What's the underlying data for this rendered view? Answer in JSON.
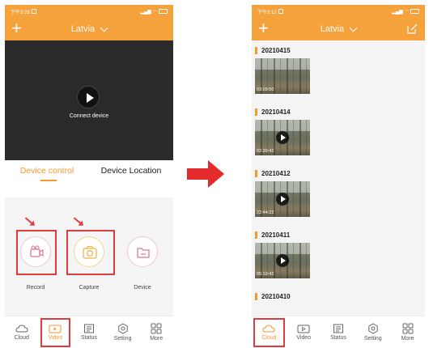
{
  "left": {
    "status_time": "下午3:28",
    "header": {
      "city": "Latvia"
    },
    "player": {
      "connect_text": "Connect device"
    },
    "tabs": [
      {
        "label": "Device control",
        "active": true
      },
      {
        "label": "Device Location",
        "active": false
      }
    ],
    "controls": [
      {
        "label": "Record",
        "icon": "video-icon"
      },
      {
        "label": "Capture",
        "icon": "camera-icon"
      },
      {
        "label": "Device",
        "icon": "folder-icon"
      }
    ],
    "nav": [
      {
        "label": "Cloud",
        "icon": "cloud-icon"
      },
      {
        "label": "Video",
        "icon": "video-icon",
        "active": true
      },
      {
        "label": "Status",
        "icon": "status-icon"
      },
      {
        "label": "Setting",
        "icon": "gear-icon"
      },
      {
        "label": "More",
        "icon": "grid-icon"
      }
    ]
  },
  "right": {
    "status_time": "下午3:12",
    "header": {
      "city": "Latvia"
    },
    "recordings": [
      {
        "date": "20210415",
        "time": "03:09:50"
      },
      {
        "date": "20210414",
        "time": "02:39:42"
      },
      {
        "date": "20210412",
        "time": "22:44:22"
      },
      {
        "date": "20210411",
        "time": "05:19:42"
      },
      {
        "date": "20210410"
      }
    ],
    "nav": [
      {
        "label": "Cloud",
        "icon": "cloud-icon",
        "active": true
      },
      {
        "label": "Video",
        "icon": "video-icon"
      },
      {
        "label": "Status",
        "icon": "status-icon"
      },
      {
        "label": "Setting",
        "icon": "gear-icon"
      },
      {
        "label": "More",
        "icon": "grid-icon"
      }
    ]
  },
  "colors": {
    "accent": "#f6a23c",
    "highlight": "#e03c3c",
    "dark": "#2a2a2a"
  }
}
